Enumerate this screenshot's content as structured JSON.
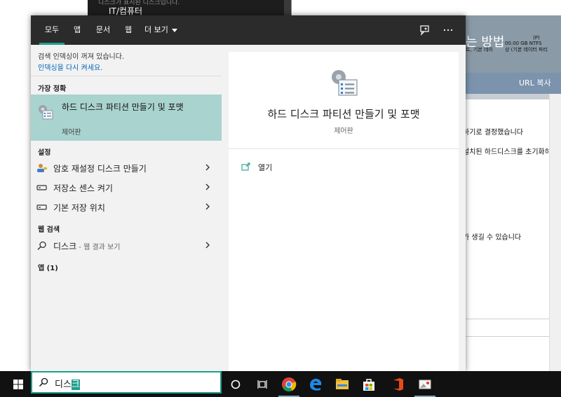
{
  "background": {
    "top_text": "IT/컴퓨터",
    "top_faint": "디스크가 표시된 디스크입니다.",
    "heading_partial": "는 방법",
    "disk_lines": [
      "(P)",
      "00.00 GB NTFS",
      "상 (기본 데이터 파티"
    ],
    "disk_line_left": "트, 기본 데이",
    "url_button": "URL 복사",
    "lines": [
      "하기로 결정했습니다",
      "설치된 하드디스크를 초기화하는",
      "가 생길 수 있습니다"
    ]
  },
  "tabs": [
    {
      "label": "모두",
      "active": true
    },
    {
      "label": "앱"
    },
    {
      "label": "문서"
    },
    {
      "label": "웹"
    },
    {
      "label": "더 보기"
    }
  ],
  "topbar_icons": [
    "feedback-icon",
    "more-options-icon"
  ],
  "notice": {
    "text": "검색 인덱싱이 꺼져 있습니다.",
    "link": "인덱싱을 다시 켜세요."
  },
  "best_match": {
    "heading": "가장 정확",
    "title": "하드 디스크 파티션 만들기 및 포맷",
    "subtitle": "제어판",
    "icon": "disk-management-icon"
  },
  "settings": {
    "heading": "설정",
    "items": [
      {
        "label": "암호 재설정 디스크 만들기",
        "icon": "user-key-icon"
      },
      {
        "label": "저장소 센스 켜기",
        "icon": "storage-icon"
      },
      {
        "label": "기본 저장 위치",
        "icon": "storage-icon"
      }
    ]
  },
  "web": {
    "heading": "웹 검색",
    "query": "디스크",
    "suffix": " - 웹 결과 보기"
  },
  "apps_heading": "앱 (1)",
  "detail": {
    "title": "하드 디스크 파티션 만들기 및 포맷",
    "subtitle": "제어판",
    "action": "열기"
  },
  "search": {
    "typed_prefix": "디스",
    "typed_highlight": "크"
  },
  "taskbar_apps": [
    "cortana-icon",
    "task-view-icon",
    "chrome-icon",
    "edge-icon",
    "file-explorer-icon",
    "store-icon",
    "office-icon",
    "photos-icon"
  ],
  "colors": {
    "accent": "#1f9e8e",
    "selected_bg": "#a9d3cf",
    "link": "#0066b8",
    "topbar": "#2b2b2b"
  }
}
